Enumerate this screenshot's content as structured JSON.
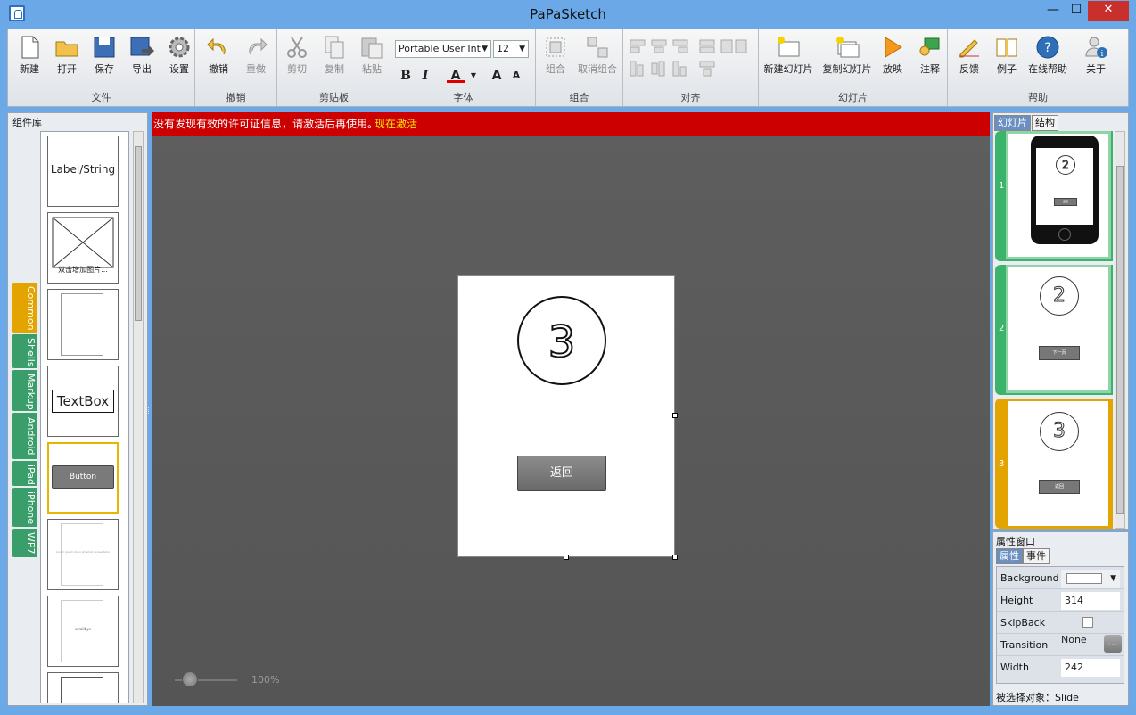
{
  "window": {
    "title": "PaPaSketch",
    "min": "—",
    "max": "☐",
    "close": "✕"
  },
  "ribbon": {
    "file": {
      "label": "文件",
      "new": "新建",
      "open": "打开",
      "save": "保存",
      "export": "导出",
      "settings": "设置"
    },
    "undo": {
      "label": "撤销",
      "undo": "撤销",
      "redo": "重做"
    },
    "clipboard": {
      "label": "剪贴板",
      "cut": "剪切",
      "copy": "复制",
      "paste": "粘贴"
    },
    "font": {
      "label": "字体",
      "family": "Portable User Int",
      "size": "12",
      "bold": "B",
      "italic": "I",
      "color": "A",
      "grow": "A",
      "shrink": "A"
    },
    "group": {
      "label": "组合",
      "group": "组合",
      "ungroup": "取消组合"
    },
    "align": {
      "label": "对齐"
    },
    "slides": {
      "label": "幻灯片",
      "new_slide": "新建幻灯片",
      "copy_slide": "复制幻灯片",
      "play": "放映",
      "annotate": "注释"
    },
    "help": {
      "label": "帮助",
      "feedback": "反馈",
      "examples": "例子",
      "online_help": "在线帮助",
      "about": "关于"
    }
  },
  "left_panel": {
    "title": "组件库",
    "tabs": [
      "Common",
      "Shells",
      "Markup",
      "Android",
      "iPad",
      "iPhone",
      "WP7"
    ],
    "components": {
      "label": "Label/String",
      "image_hint": "双击增加图片...",
      "textbox": "TextBox",
      "button": "Button",
      "comp6_text": "Lorem ipsum dolor sit amet consectetur",
      "comp7_text": "scrollbyx"
    }
  },
  "canvas": {
    "warning": "没有发现有效的许可证信息，请激活后再使用。",
    "activate": "现在激活",
    "slide": {
      "circle_number": "3",
      "button_label": "返回"
    },
    "zoom": "100%"
  },
  "right_panel": {
    "tabs": [
      "幻灯片",
      "结构"
    ],
    "slides": [
      {
        "number": "1",
        "circle": "2",
        "button": "返回"
      },
      {
        "number": "2",
        "circle": "2",
        "button": "下一页"
      },
      {
        "number": "3",
        "circle": "3",
        "button": "返回"
      }
    ]
  },
  "properties": {
    "title": "属性窗口",
    "tabs": [
      "属性",
      "事件"
    ],
    "rows": {
      "background": {
        "name": "Background",
        "value": "#ffffff"
      },
      "height": {
        "name": "Height",
        "value": "314"
      },
      "skipback": {
        "name": "SkipBack"
      },
      "transition": {
        "name": "Transition",
        "value": "None",
        "button": "..."
      },
      "width": {
        "name": "Width",
        "value": "242"
      }
    },
    "selected": "被选择对象：Slide"
  },
  "colors": {
    "warning": "#cc0000",
    "active_tab": "#e4a400",
    "tab": "#3a9e6a",
    "slide3_frame": "#e4a400"
  }
}
